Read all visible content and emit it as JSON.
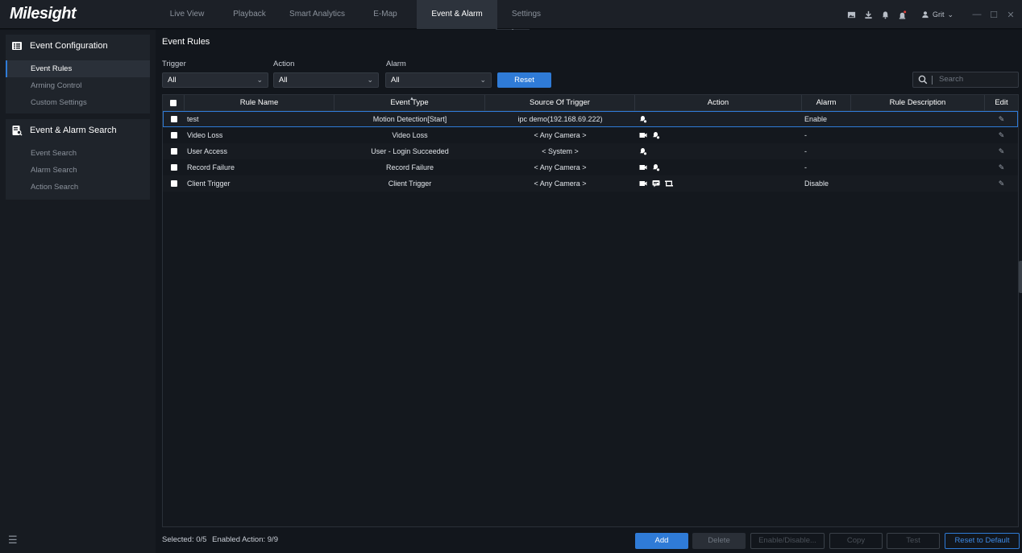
{
  "app": {
    "logo": "Milesight"
  },
  "nav": {
    "tabs": [
      {
        "label": "Live View",
        "active": false
      },
      {
        "label": "Playback",
        "active": false
      },
      {
        "label": "Smart Analytics",
        "active": false
      },
      {
        "label": "E-Map",
        "active": false
      },
      {
        "label": "Event & Alarm",
        "active": true
      },
      {
        "label": "Settings",
        "active": false
      }
    ],
    "user": "Grit"
  },
  "sidebar": {
    "groups": [
      {
        "title": "Event Configuration",
        "items": [
          "Event Rules",
          "Arming Control",
          "Custom Settings"
        ],
        "active": "Event Rules"
      },
      {
        "title": "Event & Alarm Search",
        "items": [
          "Event Search",
          "Alarm Search",
          "Action Search"
        ]
      }
    ]
  },
  "main": {
    "title": "Event Rules",
    "filters": {
      "trigger_label": "Trigger",
      "trigger_value": "All",
      "action_label": "Action",
      "action_value": "All",
      "alarm_label": "Alarm",
      "alarm_value": "All",
      "reset_label": "Reset",
      "search_placeholder": "Search"
    },
    "table": {
      "columns": [
        "Rule Name",
        "Event Type",
        "Source Of Trigger",
        "Action",
        "Alarm",
        "Rule Description",
        "Edit"
      ],
      "rows": [
        {
          "name": "test",
          "event_type": "Motion Detection[Start]",
          "source": "ipc demo(192.168.69.222)",
          "actions": [
            "alarm-bell"
          ],
          "alarm": "Enable",
          "description": ""
        },
        {
          "name": "Video Loss",
          "event_type": "Video Loss",
          "source": "< Any Camera >",
          "actions": [
            "record",
            "alarm-bell"
          ],
          "alarm": "-",
          "description": ""
        },
        {
          "name": "User Access",
          "event_type": "User - Login Succeeded",
          "source": "< System >",
          "actions": [
            "alarm-bell"
          ],
          "alarm": "-",
          "description": ""
        },
        {
          "name": "Record Failure",
          "event_type": "Record Failure",
          "source": "< Any Camera >",
          "actions": [
            "record",
            "alarm-bell"
          ],
          "alarm": "-",
          "description": ""
        },
        {
          "name": "Client Trigger",
          "event_type": "Client Trigger",
          "source": "< Any Camera >",
          "actions": [
            "record",
            "message",
            "popup"
          ],
          "alarm": "Disable",
          "description": ""
        }
      ]
    },
    "footer": {
      "selected_text": "Selected: 0/5",
      "enabled_text": "Enabled Action: 9/9",
      "add": "Add",
      "delete": "Delete",
      "enable_disable": "Enable/Disable...",
      "copy": "Copy",
      "test": "Test",
      "reset_default": "Reset to Default"
    }
  },
  "colors": {
    "accent": "#2f7bd7",
    "background": "#12161c",
    "sidebar": "#171b21"
  }
}
